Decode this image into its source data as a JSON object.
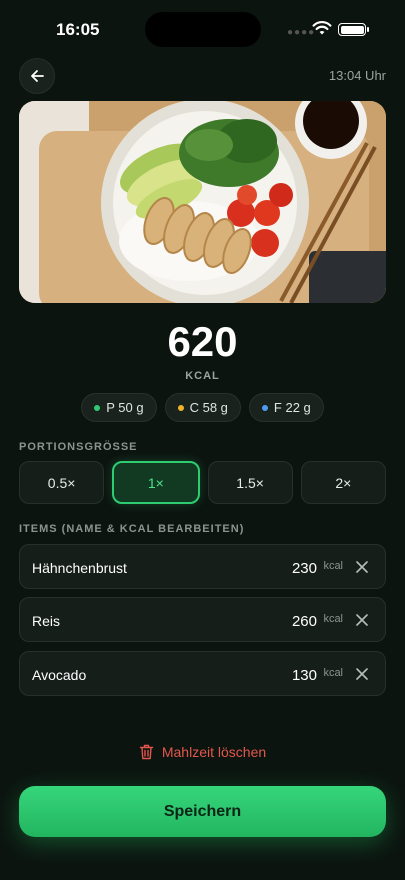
{
  "status_bar": {
    "time": "16:05",
    "signal_icon": "signal-dots-icon",
    "wifi_icon": "wifi-icon",
    "battery_icon": "battery-icon"
  },
  "header": {
    "back_icon": "arrow-left-icon",
    "meal_time": "13:04 Uhr"
  },
  "photo": {
    "description_icon": "meal-photo"
  },
  "nutrition": {
    "kcal_value": "620",
    "kcal_unit": "KCAL",
    "macros": [
      {
        "label": "P 50 g",
        "color": "#2ecc71"
      },
      {
        "label": "C 58 g",
        "color": "#f0b429"
      },
      {
        "label": "F 22 g",
        "color": "#4a9df0"
      }
    ]
  },
  "portion_section": {
    "label": "PORTIONSGRÖSSE",
    "options": [
      "0.5×",
      "1×",
      "1.5×",
      "2×"
    ],
    "selected": "1×"
  },
  "items_section": {
    "label": "ITEMS (NAME & KCAL BEARBEITEN)",
    "items": [
      {
        "name": "Hähnchenbrust",
        "kcal": "230",
        "unit": "kcal"
      },
      {
        "name": "Reis",
        "kcal": "260",
        "unit": "kcal"
      },
      {
        "name": "Avocado",
        "kcal": "130",
        "unit": "kcal"
      }
    ]
  },
  "actions": {
    "delete_label": "Mahlzeit löschen",
    "save_label": "Speichern"
  },
  "colors": {
    "accent": "#2ecc71",
    "danger": "#e2574c",
    "background": "#0c1410"
  }
}
